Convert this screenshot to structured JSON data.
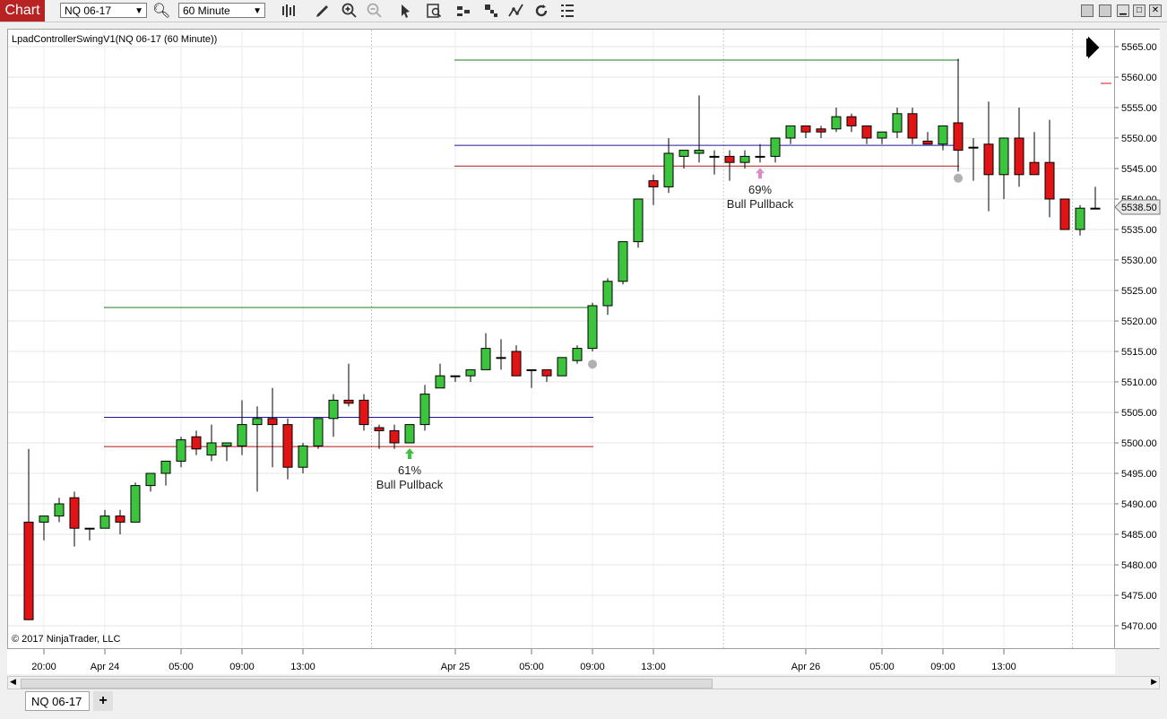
{
  "toolbar": {
    "chart_tab": "Chart",
    "instrument": "NQ 06-17",
    "interval": "60 Minute",
    "icons": [
      "bar-type-icon",
      "draw-tool-icon",
      "zoom-in-icon",
      "zoom-out-icon",
      "pointer-icon",
      "data-box-icon",
      "templates-icon",
      "strategies-icon",
      "indicators-icon",
      "reload-icon",
      "properties-icon"
    ]
  },
  "chart": {
    "indicator_title": "LpadControllerSwingV1(NQ 06-17 (60 Minute))",
    "copyright": "© 2017 NinjaTrader, LLC",
    "current_price": "5538.50",
    "colors": {
      "up": "#3cc43c",
      "down": "#e01414",
      "green_line": "#1e7e1e",
      "blue_line": "#1a1aa0",
      "red_line": "#b01818",
      "marker": "#b0b0b0"
    }
  },
  "chart_data": {
    "type": "candlestick",
    "y_ticks": [
      "5565.00",
      "5560.00",
      "5555.00",
      "5550.00",
      "5545.00",
      "5540.00",
      "5535.00",
      "5530.00",
      "5525.00",
      "5520.00",
      "5515.00",
      "5510.00",
      "5505.00",
      "5500.00",
      "5495.00",
      "5490.00",
      "5485.00",
      "5480.00",
      "5475.00",
      "5470.00"
    ],
    "ylim": [
      5467.5,
      5567.5
    ],
    "x_ticks": [
      "20:00",
      "Apr 24",
      "05:00",
      "09:00",
      "13:00",
      "Apr 25",
      "05:00",
      "09:00",
      "13:00",
      "Apr 26",
      "05:00",
      "09:00",
      "13:00"
    ],
    "candles": [
      [
        5487,
        5499,
        5471,
        5471
      ],
      [
        5487,
        5488,
        5484,
        5488
      ],
      [
        5488,
        5491,
        5487,
        5490
      ],
      [
        5491,
        5492,
        5483,
        5486
      ],
      [
        5486,
        5486,
        5484,
        5486
      ],
      [
        5486,
        5489,
        5486,
        5488
      ],
      [
        5488,
        5489,
        5485,
        5487
      ],
      [
        5487,
        5493.5,
        5487,
        5493
      ],
      [
        5493,
        5495,
        5492,
        5495
      ],
      [
        5495,
        5496.5,
        5493,
        5497
      ],
      [
        5497,
        5501,
        5496,
        5500.5
      ],
      [
        5501,
        5502,
        5498,
        5499
      ],
      [
        5498,
        5503,
        5497,
        5500
      ],
      [
        5499.5,
        5500,
        5497,
        5500
      ],
      [
        5499.5,
        5507,
        5498,
        5503
      ],
      [
        5503,
        5506,
        5492,
        5504
      ],
      [
        5504,
        5509,
        5496,
        5503
      ],
      [
        5503,
        5504,
        5494,
        5496
      ],
      [
        5496,
        5500,
        5495,
        5499.5
      ],
      [
        5499.5,
        5504,
        5499,
        5504
      ],
      [
        5504,
        5508,
        5501,
        5507
      ],
      [
        5507,
        5513,
        5506,
        5506.5
      ],
      [
        5507,
        5508,
        5502,
        5503
      ],
      [
        5502.5,
        5503,
        5499,
        5502
      ],
      [
        5502,
        5503,
        5499,
        5500
      ],
      [
        5500,
        5503,
        5500,
        5503
      ],
      [
        5503,
        5509.5,
        5502,
        5508
      ],
      [
        5509,
        5513,
        5509,
        5511
      ],
      [
        5511,
        5511,
        5510,
        5511
      ],
      [
        5511,
        5512,
        5510,
        5512
      ],
      [
        5512,
        5518,
        5512,
        5515.5
      ],
      [
        5514,
        5517,
        5512,
        5514
      ],
      [
        5515,
        5516,
        5511,
        5511
      ],
      [
        5512,
        5512,
        5509,
        5512
      ],
      [
        5512,
        5512,
        5510,
        5511
      ],
      [
        5511,
        5514,
        5511,
        5514
      ],
      [
        5513.5,
        5516,
        5513,
        5515.5
      ],
      [
        5515.5,
        5523,
        5515,
        5522.5
      ],
      [
        5522.5,
        5527,
        5521,
        5526.5
      ],
      [
        5526.5,
        5532,
        5526,
        5533
      ],
      [
        5533,
        5540,
        5532,
        5540
      ],
      [
        5543,
        5544,
        5539,
        5542
      ],
      [
        5542,
        5550,
        5541,
        5547.5
      ],
      [
        5547,
        5548,
        5545,
        5548
      ],
      [
        5547.5,
        5557,
        5546,
        5548
      ],
      [
        5547,
        5548,
        5544,
        5547
      ],
      [
        5547,
        5548,
        5543,
        5546
      ],
      [
        5546,
        5548,
        5545,
        5547
      ],
      [
        5547,
        5549,
        5546,
        5547
      ],
      [
        5547,
        5550,
        5546,
        5550
      ],
      [
        5550,
        5552,
        5549,
        5552
      ],
      [
        5552,
        5552,
        5550,
        5551
      ],
      [
        5551.5,
        5552,
        5550,
        5551
      ],
      [
        5551.5,
        5555,
        5551,
        5553.5
      ],
      [
        5553.5,
        5554,
        5551,
        5552
      ],
      [
        5552,
        5552,
        5549,
        5550
      ],
      [
        5550,
        5551,
        5549,
        5551
      ],
      [
        5551,
        5555,
        5550,
        5554
      ],
      [
        5554,
        5555,
        5549,
        5550
      ],
      [
        5549.5,
        5551,
        5549,
        5549
      ],
      [
        5549,
        5552,
        5548,
        5552
      ],
      [
        5552.5,
        5563,
        5544.5,
        5548
      ],
      [
        5548.5,
        5550,
        5543,
        5548.5
      ],
      [
        5549,
        5556,
        5538,
        5544
      ],
      [
        5544,
        5550,
        5540,
        5550
      ],
      [
        5550,
        5555,
        5542,
        5544
      ],
      [
        5546,
        5551,
        5544,
        5544
      ],
      [
        5546,
        5553,
        5537,
        5540
      ],
      [
        5540,
        5540,
        5535,
        5535
      ],
      [
        5535,
        5539,
        5534,
        5538.5
      ],
      [
        5538.5,
        5542,
        5538.5,
        5538.5
      ]
    ],
    "levels": [
      {
        "price": 5522.2,
        "from": 5,
        "to": 37,
        "color": "green"
      },
      {
        "price": 5504.2,
        "from": 5,
        "to": 37,
        "color": "blue"
      },
      {
        "price": 5499.4,
        "from": 5,
        "to": 37,
        "color": "red"
      },
      {
        "price": 5562.8,
        "from": 28,
        "to": 61,
        "color": "green"
      },
      {
        "price": 5548.8,
        "from": 28,
        "to": 61,
        "color": "blue"
      },
      {
        "price": 5545.4,
        "from": 28,
        "to": 61,
        "color": "red"
      }
    ],
    "signals": [
      {
        "bar": 25,
        "percent": "61%",
        "label": "Bull Pullback",
        "color": "#3cc43c"
      },
      {
        "bar": 48,
        "percent": "69%",
        "label": "Bull Pullback",
        "color": "#d98cc8"
      }
    ],
    "swing_markers": [
      {
        "bar": 37,
        "price": 5513.5
      },
      {
        "bar": 61,
        "price": 5544
      }
    ]
  },
  "bottom": {
    "tab": "NQ 06-17",
    "add": "+"
  }
}
